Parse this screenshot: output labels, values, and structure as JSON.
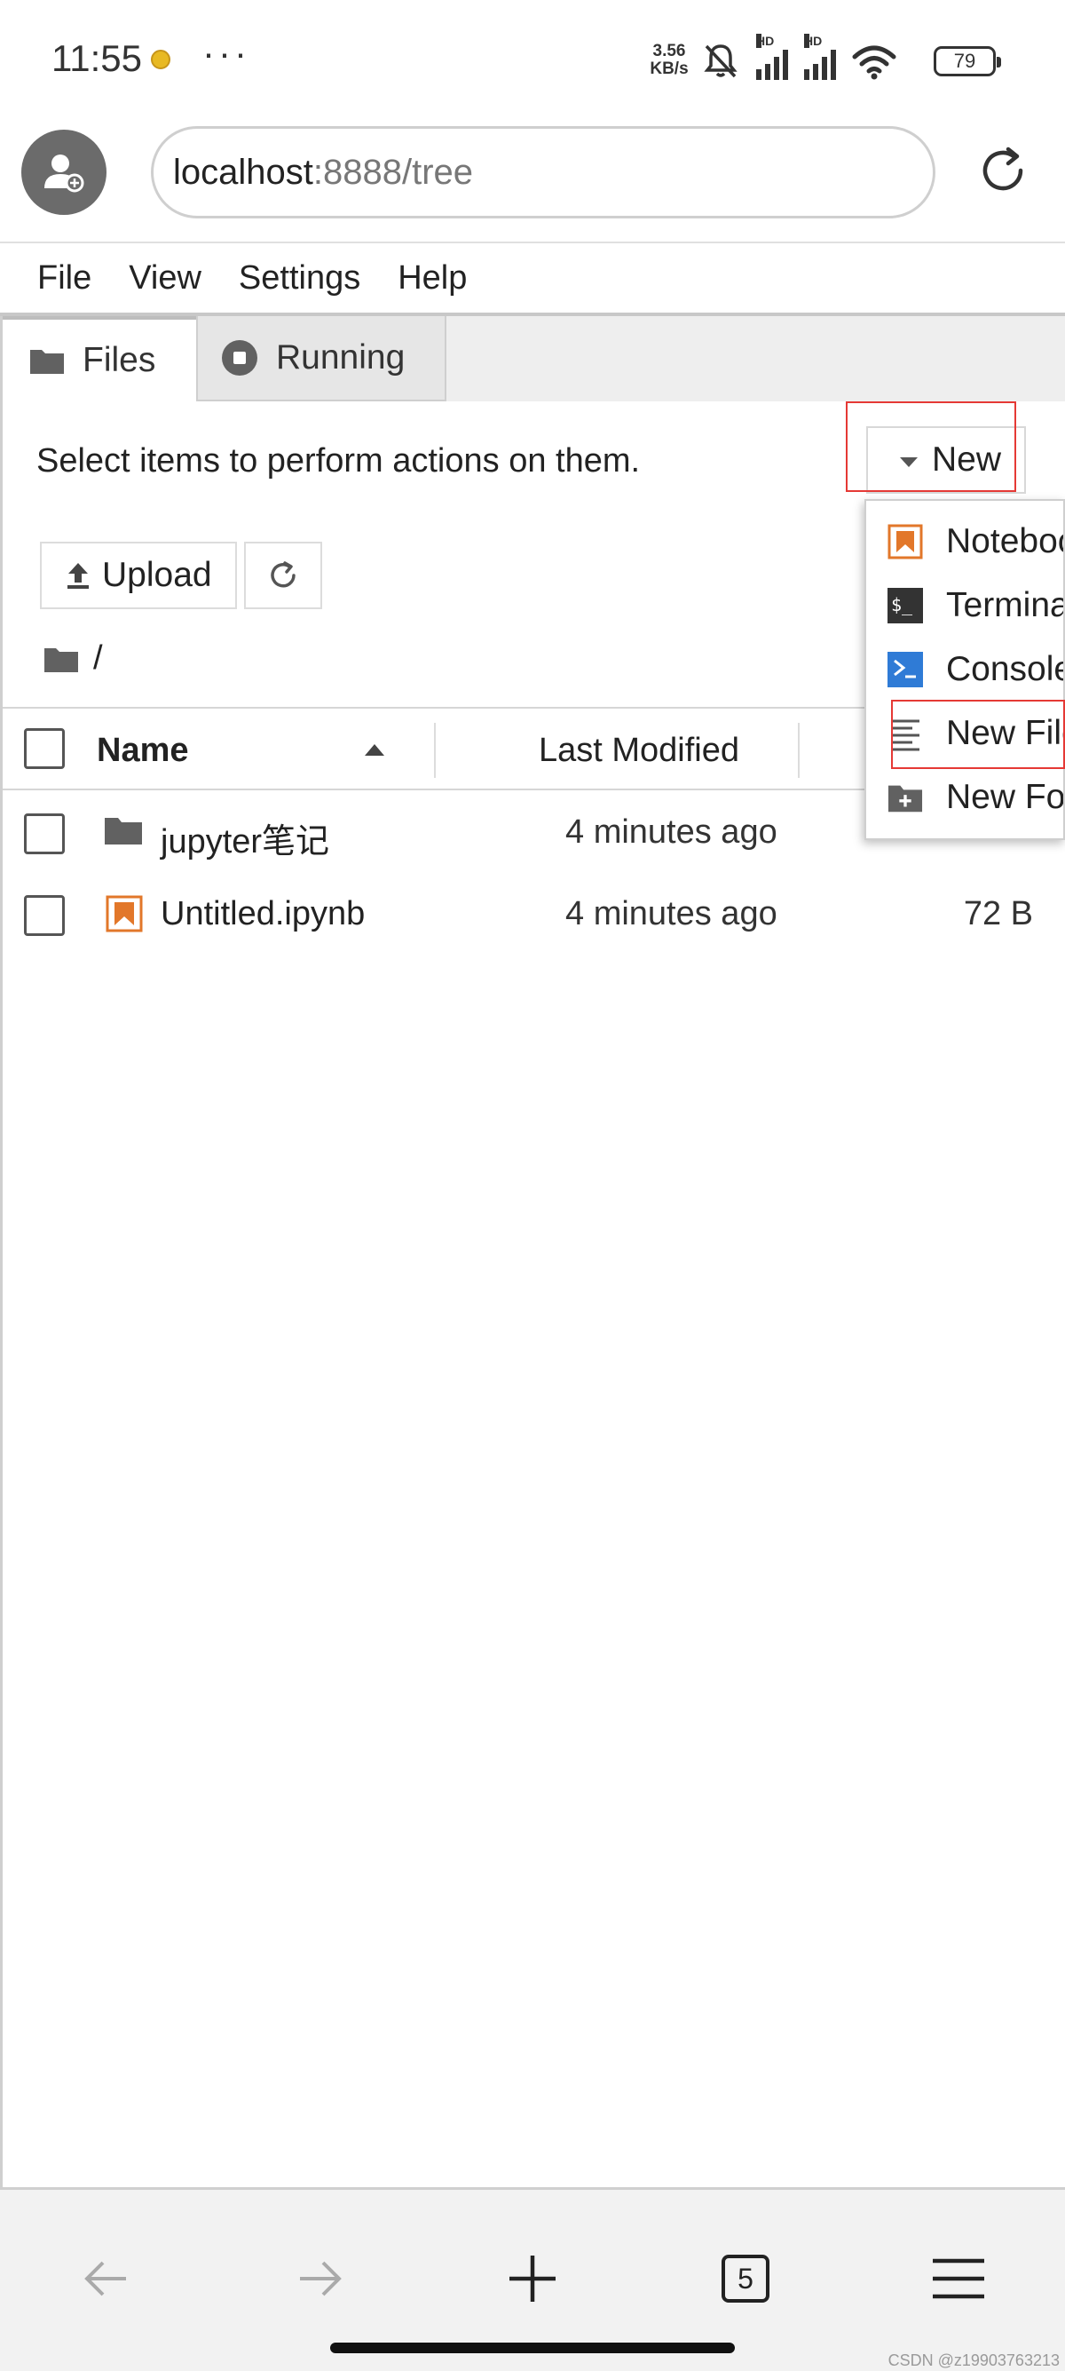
{
  "status": {
    "time": "11:55",
    "dots": "···",
    "speed_value": "3.56",
    "speed_unit": "KB/s",
    "hd1": "HD",
    "hd2": "HD",
    "battery": "79"
  },
  "browser": {
    "url_host": "localhost",
    "url_path": ":8888/tree",
    "tab_count": "5"
  },
  "menu": [
    "File",
    "View",
    "Settings",
    "Help"
  ],
  "tabs": [
    {
      "label": "Files",
      "icon": "folder-icon"
    },
    {
      "label": "Running",
      "icon": "stop-circle-icon"
    }
  ],
  "toolbar": {
    "hint": "Select items to perform actions on them.",
    "new_label": "New",
    "upload_label": "Upload",
    "breadcrumb": "/"
  },
  "columns": {
    "name": "Name",
    "modified": "Last Modified"
  },
  "files": [
    {
      "name": "jupyter笔记",
      "modified": "4 minutes ago",
      "size": "",
      "icon": "folder-icon"
    },
    {
      "name": "Untitled.ipynb",
      "modified": "4 minutes ago",
      "size": "72 B",
      "icon": "notebook-icon"
    }
  ],
  "new_menu": [
    {
      "label": "Notebook",
      "icon": "notebook-icon"
    },
    {
      "label": "Terminal",
      "icon": "terminal-icon"
    },
    {
      "label": "Console",
      "icon": "console-icon"
    },
    {
      "label": "New File",
      "icon": "text-file-icon"
    },
    {
      "label": "New Folder",
      "icon": "new-folder-icon"
    }
  ],
  "watermark": "CSDN @z19903763213",
  "colors": {
    "accent_orange": "#e2772a",
    "console_blue": "#2f7bd6",
    "highlight_red": "#e53935",
    "icon_gray": "#616161"
  }
}
